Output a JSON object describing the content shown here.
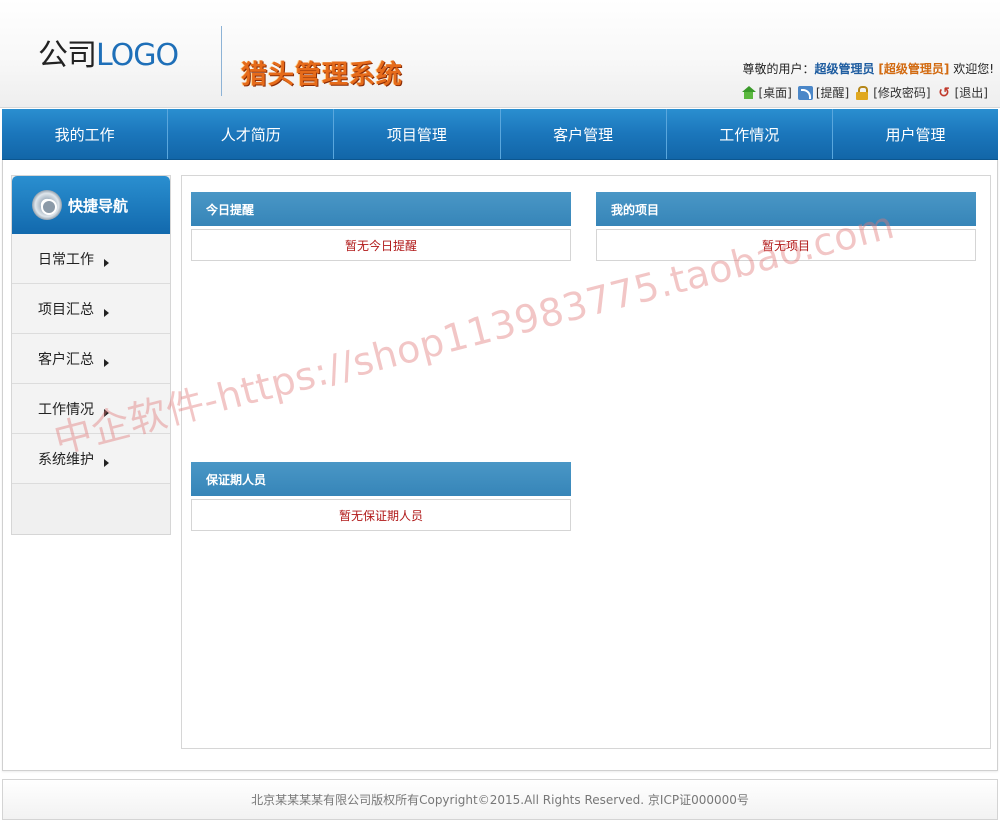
{
  "header": {
    "logo_prefix": "公司",
    "logo_word": "LOGO",
    "system_title": "猎头管理系统",
    "greeting_prefix": "尊敬的用户：",
    "user_name": "超级管理员",
    "user_role": "[超级管理员]",
    "greeting_suffix": "欢迎您!",
    "links": [
      {
        "label": "[桌面]",
        "icon": "home-icon"
      },
      {
        "label": "[提醒]",
        "icon": "rss-icon"
      },
      {
        "label": "[修改密码]",
        "icon": "lock-icon"
      },
      {
        "label": "[退出]",
        "icon": "exit-icon"
      }
    ]
  },
  "nav": {
    "items": [
      "我的工作",
      "人才简历",
      "项目管理",
      "客户管理",
      "工作情况",
      "用户管理"
    ]
  },
  "sidebar": {
    "title": "快捷导航",
    "items": [
      "日常工作",
      "项目汇总",
      "客户汇总",
      "工作情况",
      "系统维护"
    ]
  },
  "panels": {
    "today": {
      "title": "今日提醒",
      "empty": "暂无今日提醒"
    },
    "projects": {
      "title": "我的项目",
      "empty": "暂无项目"
    },
    "warranty": {
      "title": "保证期人员",
      "empty": "暂无保证期人员"
    }
  },
  "watermark": "中企软件-https://shop113983775.taobao.com",
  "footer": {
    "copyright": "北京某某某某有限公司版权所有Copyright©2015.All Rights Reserved. 京ICP证000000号"
  },
  "colors": {
    "nav_blue": "#1b76bb",
    "panel_head": "#3d8cbf",
    "empty_text": "#b01818",
    "title_orange": "#e66b1a"
  }
}
